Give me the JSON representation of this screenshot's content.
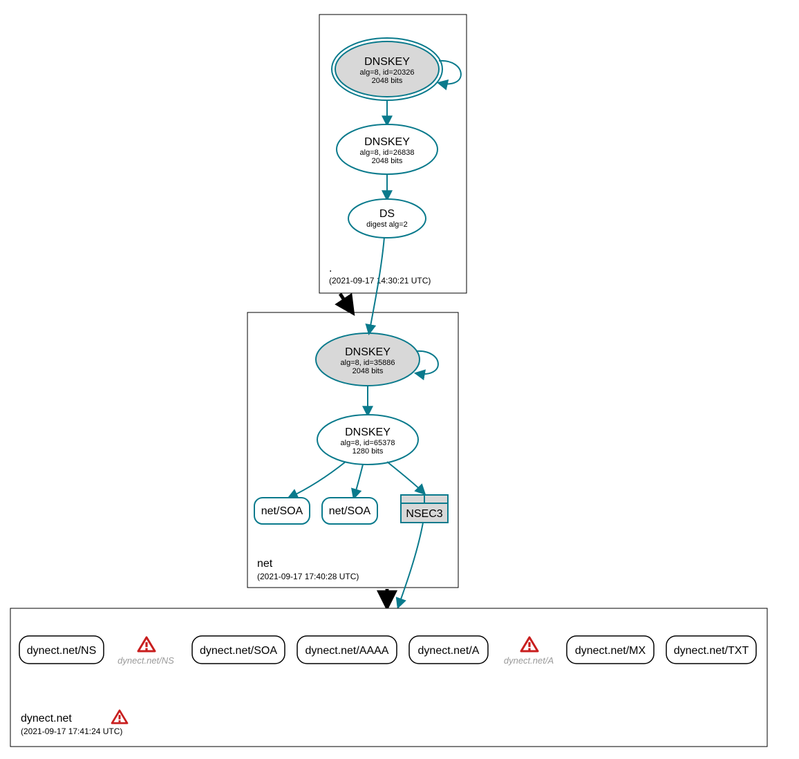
{
  "colors": {
    "teal": "#0a7a8c",
    "grey": "#d8d8d8",
    "warn_red": "#c81e1e",
    "warn_border": "#000"
  },
  "zones": {
    "root": {
      "name": ".",
      "timestamp": "(2021-09-17 14:30:21 UTC)"
    },
    "net": {
      "name": "net",
      "timestamp": "(2021-09-17 17:40:28 UTC)"
    },
    "dynect": {
      "name": "dynect.net",
      "timestamp": "(2021-09-17 17:41:24 UTC)"
    }
  },
  "nodes": {
    "root_ksk": {
      "title": "DNSKEY",
      "line1": "alg=8, id=20326",
      "line2": "2048 bits"
    },
    "root_zsk": {
      "title": "DNSKEY",
      "line1": "alg=8, id=26838",
      "line2": "2048 bits"
    },
    "root_ds": {
      "title": "DS",
      "line1": "digest alg=2"
    },
    "net_ksk": {
      "title": "DNSKEY",
      "line1": "alg=8, id=35886",
      "line2": "2048 bits"
    },
    "net_zsk": {
      "title": "DNSKEY",
      "line1": "alg=8, id=65378",
      "line2": "1280 bits"
    },
    "net_soa1": {
      "title": "net/SOA"
    },
    "net_soa2": {
      "title": "net/SOA"
    },
    "net_nsec3": {
      "title": "NSEC3"
    },
    "d_ns": {
      "title": "dynect.net/NS"
    },
    "d_ns_warn": {
      "title": "dynect.net/NS"
    },
    "d_soa": {
      "title": "dynect.net/SOA"
    },
    "d_aaaa": {
      "title": "dynect.net/AAAA"
    },
    "d_a": {
      "title": "dynect.net/A"
    },
    "d_a_warn": {
      "title": "dynect.net/A"
    },
    "d_mx": {
      "title": "dynect.net/MX"
    },
    "d_txt": {
      "title": "dynect.net/TXT"
    }
  }
}
